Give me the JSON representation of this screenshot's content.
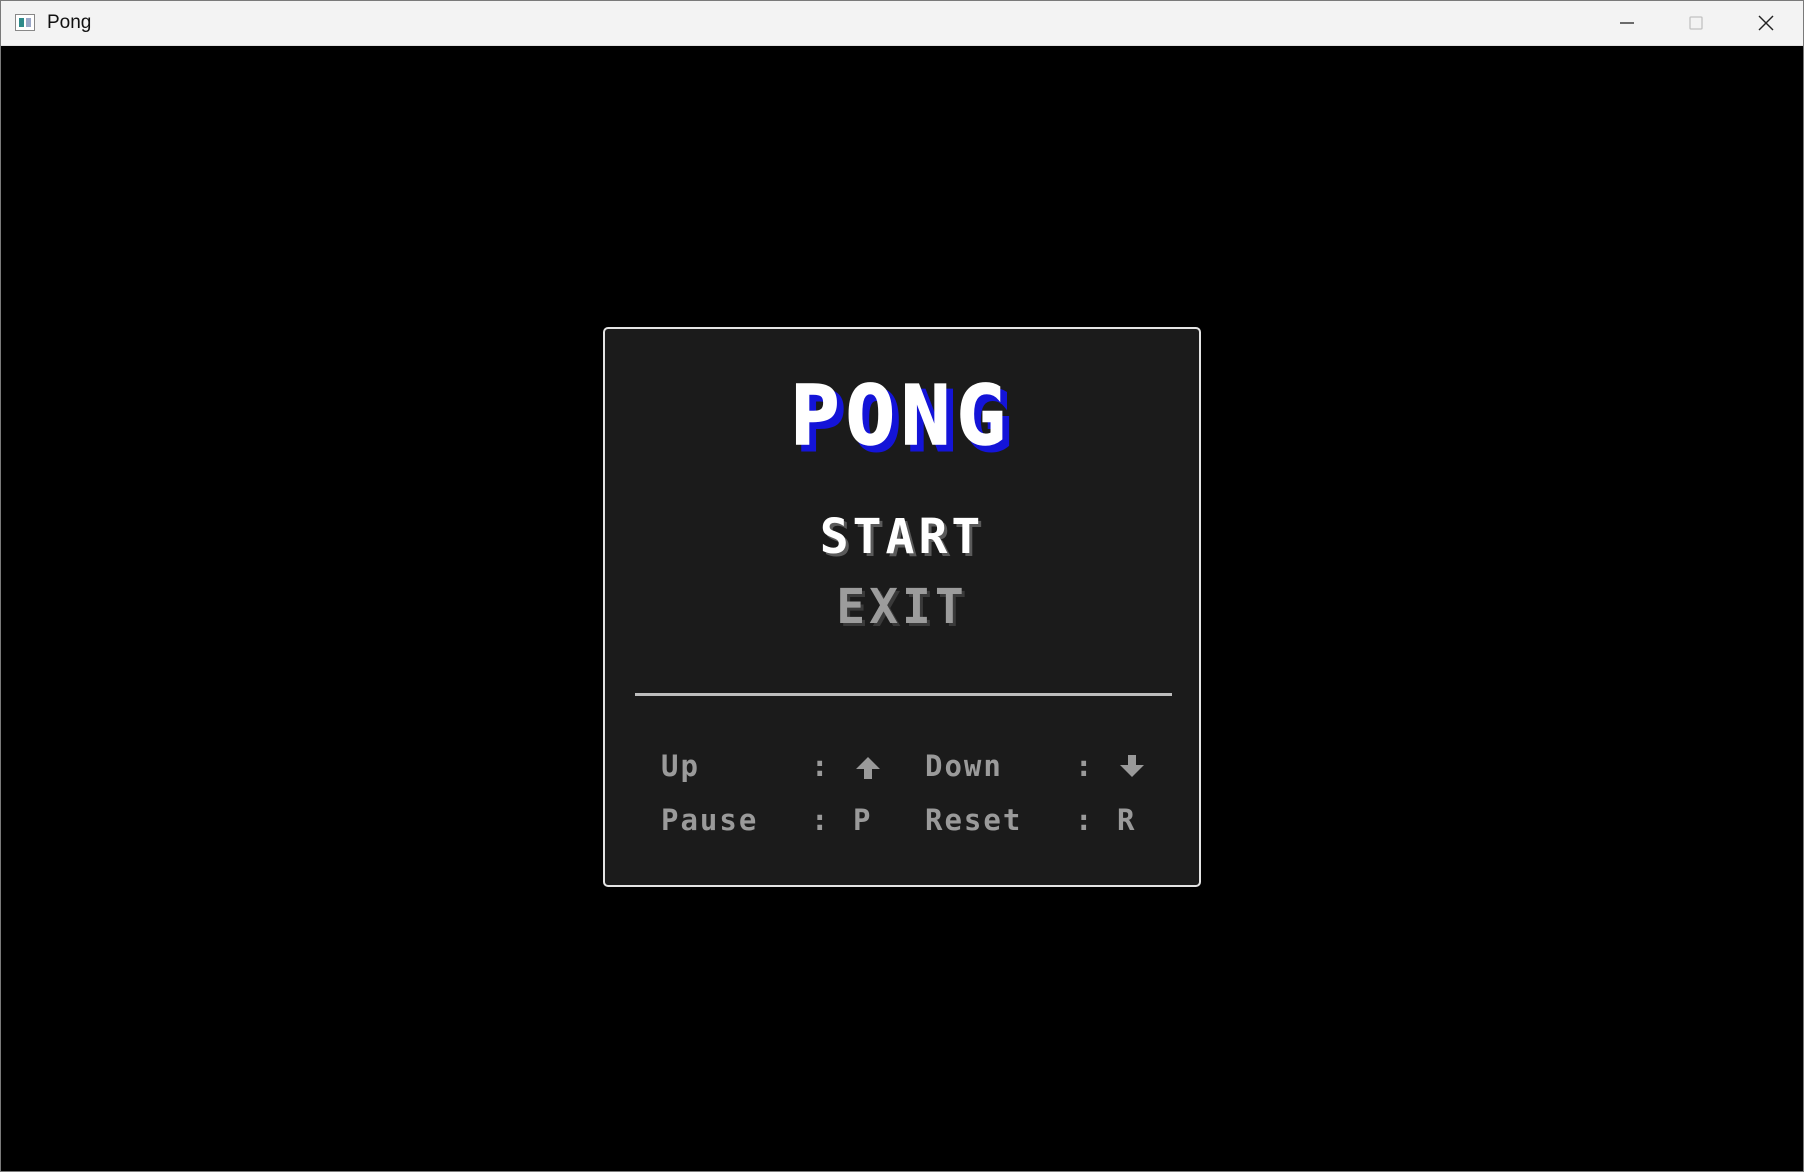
{
  "window": {
    "title": "Pong"
  },
  "title_controls": {
    "minimize_icon": "minimize-icon",
    "maximize_icon": "maximize-icon",
    "close_icon": "close-icon"
  },
  "game": {
    "title": "PONG",
    "title_fill_color": "#ffffff",
    "title_shadow_color": "#1414d8",
    "menu": {
      "start_label": "START",
      "exit_label": "EXIT",
      "selected": "START"
    },
    "controls": [
      {
        "action": "Up",
        "separator": ":",
        "key": "↑",
        "key_icon": "up-arrow-icon"
      },
      {
        "action": "Down",
        "separator": ":",
        "key": "↓",
        "key_icon": "down-arrow-icon"
      },
      {
        "action": "Pause",
        "separator": ":",
        "key": "P"
      },
      {
        "action": "Reset",
        "separator": ":",
        "key": "R"
      }
    ]
  },
  "colors": {
    "background": "#000000",
    "panel_background": "#1b1b1b",
    "panel_border": "#e4e4e4",
    "menu_selected": "#ffffff",
    "menu_unselected": "#9c9c9c",
    "controls_text": "#9a9a9a"
  }
}
